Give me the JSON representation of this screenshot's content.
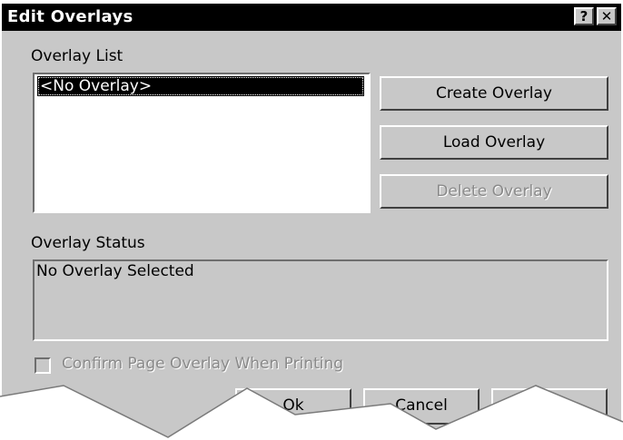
{
  "window": {
    "title": "Edit Overlays",
    "help_glyph": "?",
    "close_glyph": "✕"
  },
  "overlay_list": {
    "label": "Overlay List",
    "items": [
      "<No Overlay>"
    ],
    "selected_index": 0
  },
  "actions": {
    "create_label": "Create Overlay",
    "load_label": "Load Overlay",
    "delete_label": "Delete Overlay",
    "delete_enabled": false
  },
  "status": {
    "label": "Overlay Status",
    "text": "No Overlay Selected"
  },
  "confirm": {
    "label": "Confirm Page Overlay When Printing",
    "checked": false,
    "enabled": false
  },
  "footer": {
    "ok_label": "Ok",
    "cancel_label": "Cancel",
    "help_label": ""
  }
}
